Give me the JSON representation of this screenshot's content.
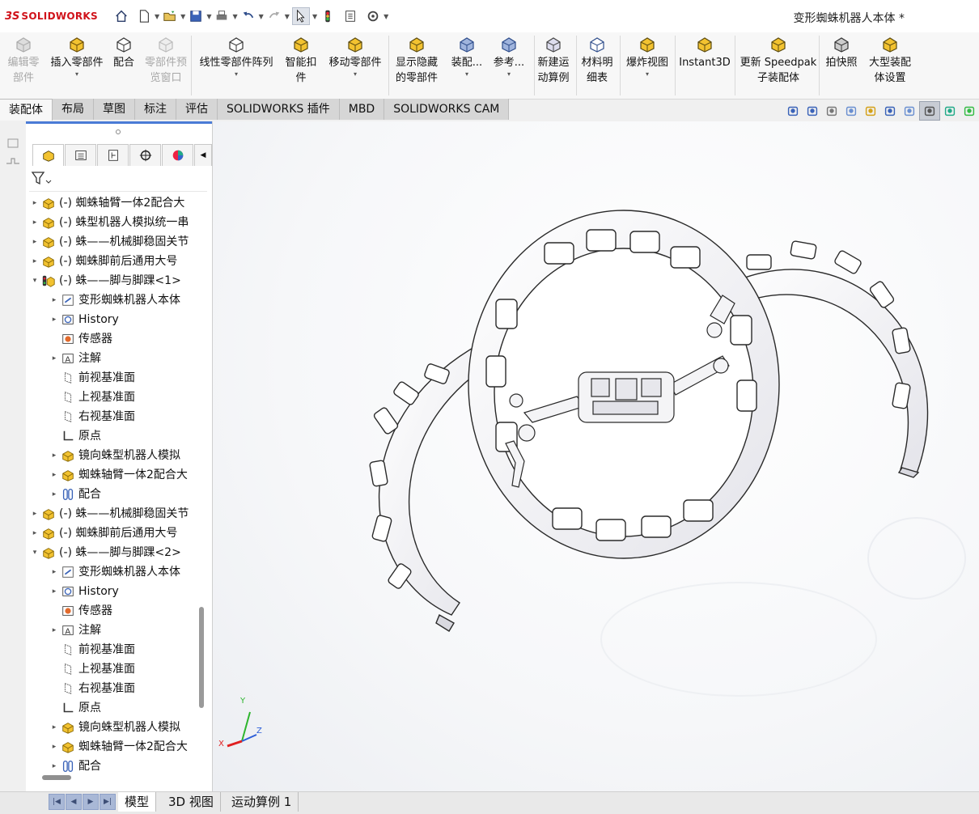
{
  "app": {
    "logo_ds": "3S",
    "logo_text": "SOLIDWORKS",
    "document_title": "变形蜘蛛机器人本体 *"
  },
  "quick_access": {
    "icons": [
      "home-icon",
      "new-document-icon",
      "open-icon",
      "save-icon",
      "print-icon",
      "undo-icon",
      "redo-icon",
      "select-icon",
      "rebuild-icon",
      "file-properties-icon",
      "options-icon"
    ]
  },
  "ribbon": {
    "items": [
      {
        "label1": "编辑零",
        "label2": "部件",
        "icon": "edit-component-icon",
        "disabled": true
      },
      {
        "label1": "插入零部件",
        "label2": "",
        "icon": "insert-components-icon",
        "caret": true
      },
      {
        "label1": "配合",
        "label2": "",
        "icon": "mate-icon"
      },
      {
        "label1": "零部件预",
        "label2": "览窗口",
        "icon": "component-preview-icon",
        "disabled": true
      },
      {
        "label1": "线性零部件阵列",
        "label2": "",
        "icon": "linear-pattern-icon",
        "caret": true
      },
      {
        "label1": "智能扣",
        "label2": "件",
        "icon": "smart-fasteners-icon"
      },
      {
        "label1": "移动零部件",
        "label2": "",
        "icon": "move-component-icon",
        "caret": true
      },
      {
        "label1": "显示隐藏",
        "label2": "的零部件",
        "icon": "show-hidden-icon"
      },
      {
        "label1": "装配...",
        "label2": "",
        "icon": "assembly-features-icon",
        "caret": true
      },
      {
        "label1": "参考...",
        "label2": "",
        "icon": "reference-geometry-icon",
        "caret": true
      },
      {
        "label1": "新建运",
        "label2": "动算例",
        "icon": "new-motion-study-icon"
      },
      {
        "label1": "材料明",
        "label2": "细表",
        "icon": "bom-icon"
      },
      {
        "label1": "爆炸视图",
        "label2": "",
        "icon": "exploded-view-icon",
        "caret": true
      },
      {
        "label1": "Instant3D",
        "label2": "",
        "icon": "instant3d-icon"
      },
      {
        "label1": "更新 Speedpak",
        "label2": "子装配体",
        "icon": "speedpak-icon"
      },
      {
        "label1": "拍快照",
        "label2": "",
        "icon": "snapshot-icon"
      },
      {
        "label1": "大型装配",
        "label2": "体设置",
        "icon": "large-assembly-icon"
      }
    ]
  },
  "command_tabs": [
    "装配体",
    "布局",
    "草图",
    "标注",
    "评估",
    "SOLIDWORKS 插件",
    "MBD",
    "SOLIDWORKS CAM"
  ],
  "active_command_tab": "装配体",
  "view_tools": [
    "zoom-to-fit-icon",
    "zoom-area-icon",
    "previous-view-icon",
    "section-view-icon",
    "dynamic-annotation-icon",
    "view-orientation-icon",
    "display-style-icon",
    "hide-show-items-icon",
    "edit-appearance-icon",
    "apply-scene-icon"
  ],
  "panel_tabs": [
    "featuremanager-tab",
    "propertymanager-tab",
    "configurationmanager-tab",
    "dimxpert-tab",
    "display-manager-tab"
  ],
  "tree": {
    "rows": [
      {
        "level": 0,
        "exp": "▸",
        "icon": "subassembly-icon",
        "text": "(-) 蜘蛛轴臂一体2配合大"
      },
      {
        "level": 0,
        "exp": "▸",
        "icon": "subassembly-icon",
        "text": "(-) 蛛型机器人模拟统一串"
      },
      {
        "level": 0,
        "exp": "▸",
        "icon": "subassembly-icon",
        "text": "(-) 蛛——机械脚稳固关节"
      },
      {
        "level": 0,
        "exp": "▸",
        "icon": "subassembly-icon",
        "text": "(-) 蜘蛛脚前后通用大号"
      },
      {
        "level": 0,
        "exp": "▾",
        "icon": "subassembly-open-icon",
        "text": "(-) 蛛——脚与脚踝<1>"
      },
      {
        "level": 1,
        "exp": "▸",
        "icon": "document-icon",
        "text": "变形蜘蛛机器人本体"
      },
      {
        "level": 1,
        "exp": "▸",
        "icon": "history-icon",
        "text": "History"
      },
      {
        "level": 1,
        "exp": "",
        "icon": "sensor-icon",
        "text": "传感器"
      },
      {
        "level": 1,
        "exp": "▸",
        "icon": "annotation-icon",
        "text": "注解"
      },
      {
        "level": 1,
        "exp": "",
        "icon": "plane-icon",
        "text": "前视基准面"
      },
      {
        "level": 1,
        "exp": "",
        "icon": "plane-icon",
        "text": "上视基准面"
      },
      {
        "level": 1,
        "exp": "",
        "icon": "plane-icon",
        "text": "右视基准面"
      },
      {
        "level": 1,
        "exp": "",
        "icon": "origin-icon",
        "text": "原点"
      },
      {
        "level": 1,
        "exp": "▸",
        "icon": "subassembly-icon",
        "text": "镜向蛛型机器人模拟"
      },
      {
        "level": 1,
        "exp": "▸",
        "icon": "subassembly-icon",
        "text": "蜘蛛轴臂一体2配合大"
      },
      {
        "level": 1,
        "exp": "▸",
        "icon": "mates-icon",
        "text": "配合"
      },
      {
        "level": 0,
        "exp": "▸",
        "icon": "subassembly-icon",
        "text": "(-) 蛛——机械脚稳固关节"
      },
      {
        "level": 0,
        "exp": "▸",
        "icon": "subassembly-icon",
        "text": "(-) 蜘蛛脚前后通用大号"
      },
      {
        "level": 0,
        "exp": "▾",
        "icon": "subassembly-icon",
        "text": "(-) 蛛——脚与脚踝<2>"
      },
      {
        "level": 1,
        "exp": "▸",
        "icon": "document-icon",
        "text": "变形蜘蛛机器人本体"
      },
      {
        "level": 1,
        "exp": "▸",
        "icon": "history-icon",
        "text": "History"
      },
      {
        "level": 1,
        "exp": "",
        "icon": "sensor-icon",
        "text": "传感器"
      },
      {
        "level": 1,
        "exp": "▸",
        "icon": "annotation-icon",
        "text": "注解"
      },
      {
        "level": 1,
        "exp": "",
        "icon": "plane-icon",
        "text": "前视基准面"
      },
      {
        "level": 1,
        "exp": "",
        "icon": "plane-icon",
        "text": "上视基准面"
      },
      {
        "level": 1,
        "exp": "",
        "icon": "plane-icon",
        "text": "右视基准面"
      },
      {
        "level": 1,
        "exp": "",
        "icon": "origin-icon",
        "text": "原点"
      },
      {
        "level": 1,
        "exp": "▸",
        "icon": "subassembly-icon",
        "text": "镜向蛛型机器人模拟"
      },
      {
        "level": 1,
        "exp": "▸",
        "icon": "subassembly-icon",
        "text": "蜘蛛轴臂一体2配合大"
      },
      {
        "level": 1,
        "exp": "▸",
        "icon": "mates-icon",
        "text": "配合"
      }
    ]
  },
  "triad": {
    "x": "X",
    "y": "Y",
    "z": "Z"
  },
  "bottom_tabs": [
    "模型",
    "3D 视图",
    "运动算例 1"
  ],
  "active_bottom_tab": "模型",
  "colors": {
    "brand": "#d0121a",
    "accent": "#1f5fbf",
    "selection": "#d7e6fb"
  }
}
